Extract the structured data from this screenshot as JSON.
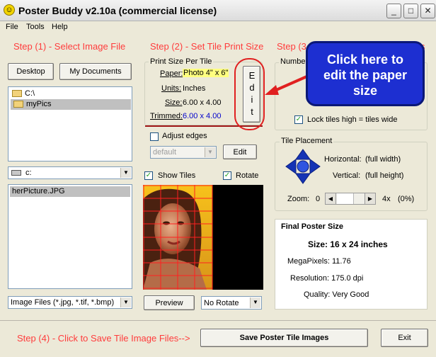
{
  "window": {
    "title": "Poster Buddy v2.10a (commercial license)",
    "icon": "smiley-icon"
  },
  "menu": [
    "File",
    "Tools",
    "Help"
  ],
  "steps": {
    "step1": "Step (1) - Select Image File",
    "step2": "Step (2) - Set Tile Print Size",
    "step3": "Step (3",
    "step3_tail": "s",
    "step4": "Step (4) - Click to Save Tile Image Files-->"
  },
  "left": {
    "desktop_button": "Desktop",
    "mydocs_button": "My Documents",
    "folders": [
      "C:\\",
      "myPics"
    ],
    "drive": "c:",
    "files": [
      "herPicture.JPG"
    ],
    "filter": "Image Files (*.jpg, *.tif, *.bmp)"
  },
  "tile": {
    "group_title": "Print Size Per Tile",
    "paper_label": "Paper:",
    "paper_value": "Photo 4\" x 6\"",
    "units_label": "Units:",
    "units_value": "Inches",
    "size_label": "Size:",
    "size_value": "6.00 x 4.00",
    "trimmed_label": "Trimmed:",
    "trimmed_value": "6.00 x 4.00",
    "edit_vertical": "Edit",
    "adjust_edges_label": "Adjust edges",
    "adjust_edges_checked": false,
    "edge_preset": "default",
    "edge_edit_button": "Edit",
    "show_tiles_label": "Show Tiles",
    "show_tiles_checked": true,
    "rotate_label": "Rotate",
    "rotate_checked": true,
    "preview_button": "Preview",
    "rotate_select": "No Rotate"
  },
  "right": {
    "number_label": "Number",
    "lock_label": "Lock tiles high = tiles wide",
    "lock_checked": true,
    "placement_title": "Tile Placement",
    "horizontal_label": "Horizontal:",
    "horizontal_value": "(full width)",
    "vertical_label": "Vertical:",
    "vertical_value": "(full height)",
    "zoom_label": "Zoom:",
    "zoom_min": "0",
    "zoom_max": "4x",
    "zoom_value": "(0%)",
    "final_title": "Final Poster Size",
    "size_text": "Size:  16 x 24 inches",
    "megapixels_text": "MegaPixels: 11.76",
    "resolution_text": "Resolution: 175.0 dpi",
    "quality_text": "Quality: Very Good"
  },
  "bottom": {
    "save_button": "Save Poster Tile Images",
    "exit_button": "Exit"
  },
  "callout": {
    "line1": "Click here to",
    "line2": "edit the paper",
    "line3": "size"
  },
  "colors": {
    "step_red": "#ff3c3c",
    "paper_highlight": "#ffff80",
    "trimmed_blue": "#0000cc",
    "callout_blue": "#1d2fd1",
    "annotation_red": "#e02020"
  }
}
